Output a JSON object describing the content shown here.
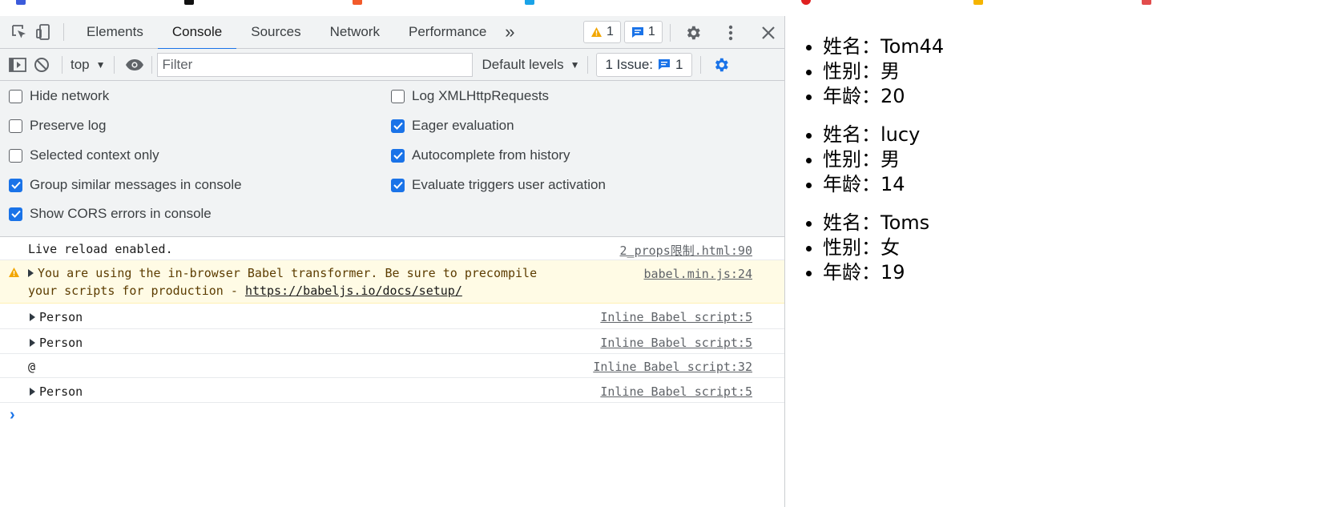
{
  "devtools": {
    "tabs": [
      "Elements",
      "Console",
      "Sources",
      "Network",
      "Performance"
    ],
    "active_tab": "Console",
    "more_tabs_glyph": "»",
    "warning_count": "1",
    "message_count": "1",
    "toolbar": {
      "context": "top",
      "filter_placeholder": "Filter",
      "levels": "Default levels",
      "issues_label": "1 Issue:",
      "issues_count": "1"
    },
    "settings": {
      "left": [
        {
          "label": "Hide network",
          "checked": false
        },
        {
          "label": "Preserve log",
          "checked": false
        },
        {
          "label": "Selected context only",
          "checked": false
        },
        {
          "label": "Group similar messages in console",
          "checked": true
        },
        {
          "label": "Show CORS errors in console",
          "checked": true
        }
      ],
      "right": [
        {
          "label": "Log XMLHttpRequests",
          "checked": false
        },
        {
          "label": "Eager evaluation",
          "checked": true
        },
        {
          "label": "Autocomplete from history",
          "checked": true
        },
        {
          "label": "Evaluate triggers user activation",
          "checked": true
        }
      ]
    },
    "console": {
      "messages": [
        {
          "text": "Live reload enabled.",
          "source": "2_props限制.html:90"
        },
        {
          "text_line1": "You are using the in-browser Babel transformer. Be sure to precompile",
          "text_line2_prefix": "your scripts for production - ",
          "link": "https://babeljs.io/docs/setup/",
          "source": "babel.min.js:24"
        },
        {
          "text": "Person",
          "source": "Inline Babel script:5"
        },
        {
          "text": "Person",
          "source": "Inline Babel script:5"
        },
        {
          "text": "@",
          "source": "Inline Babel script:32"
        },
        {
          "text": "Person",
          "source": "Inline Babel script:5"
        }
      ],
      "prompt": "›"
    },
    "colors": {
      "accent": "#1a73e8",
      "warning_bg": "#fffbe5",
      "warning_icon": "#f2a600"
    }
  },
  "page": {
    "people": [
      [
        "姓名：Tom44",
        "性别：男",
        "年龄：20"
      ],
      [
        "姓名：lucy",
        "性别：男",
        "年龄：14"
      ],
      [
        "姓名：Toms",
        "性别：女",
        "年龄：19"
      ]
    ]
  }
}
